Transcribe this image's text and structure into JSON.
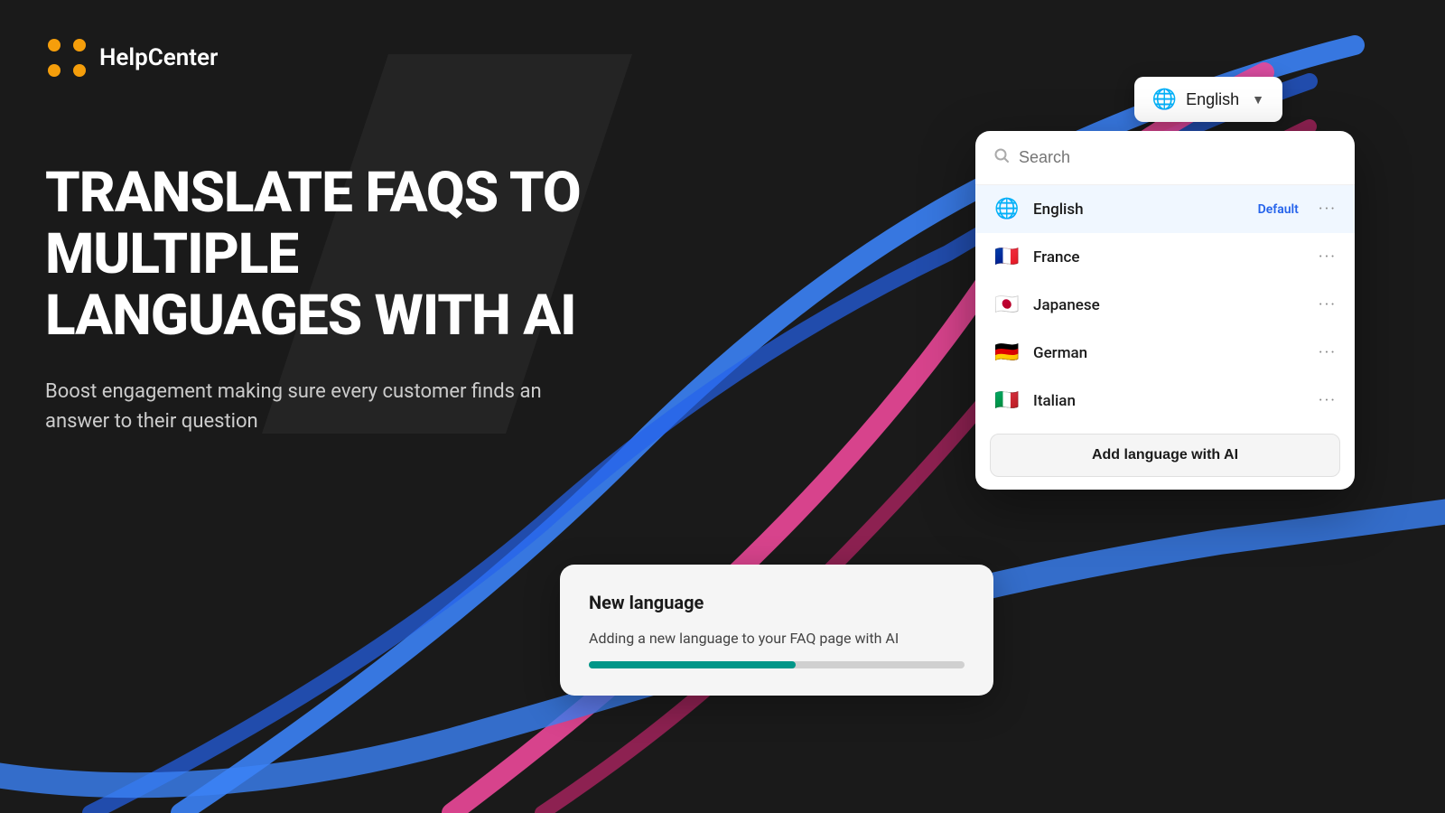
{
  "logo": {
    "text": "HelpCenter",
    "icon_color": "#F59E0B"
  },
  "hero": {
    "title": "Translate FAQs to multiple languages with AI",
    "subtitle": "Boost engagement making sure every customer finds an answer to their question"
  },
  "lang_selector": {
    "current_lang": "English",
    "globe_icon": "🌐",
    "chevron": "▼"
  },
  "search": {
    "placeholder": "Search"
  },
  "languages": [
    {
      "flag": "🌐",
      "name": "English",
      "default": true
    },
    {
      "flag": "🇫🇷",
      "name": "France",
      "default": false
    },
    {
      "flag": "🇯🇵",
      "name": "Japanese",
      "default": false
    },
    {
      "flag": "🇩🇪",
      "name": "German",
      "default": false
    },
    {
      "flag": "🇮🇹",
      "name": "Italian",
      "default": false
    }
  ],
  "add_lang_btn": "Add language with AI",
  "new_lang_card": {
    "title": "New language",
    "description": "Adding a new language to your FAQ page with AI",
    "progress": 55
  },
  "labels": {
    "default": "Default"
  }
}
